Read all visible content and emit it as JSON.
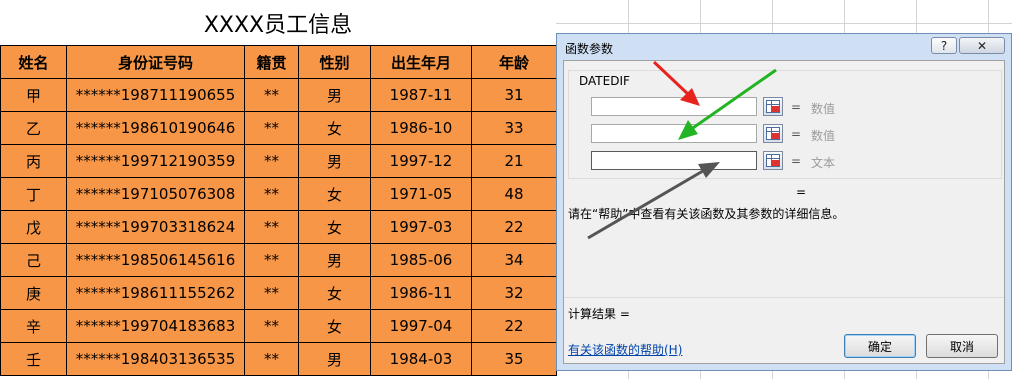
{
  "sheet": {
    "title": "XXXX员工信息",
    "headers": [
      "姓名",
      "身份证号码",
      "籍贯",
      "性别",
      "出生年月",
      "年龄"
    ],
    "rows": [
      [
        "甲",
        "******198711190655",
        "**",
        "男",
        "1987-11",
        "31"
      ],
      [
        "乙",
        "******198610190646",
        "**",
        "女",
        "1986-10",
        "33"
      ],
      [
        "丙",
        "******199712190359",
        "**",
        "男",
        "1997-12",
        "21"
      ],
      [
        "丁",
        "******197105076308",
        "**",
        "女",
        "1971-05",
        "48"
      ],
      [
        "戊",
        "******199703318624",
        "**",
        "女",
        "1997-03",
        "22"
      ],
      [
        "己",
        "******198506145616",
        "**",
        "男",
        "1985-06",
        "34"
      ],
      [
        "庚",
        "******198611155262",
        "**",
        "女",
        "1986-11",
        "32"
      ],
      [
        "辛",
        "******199704183683",
        "**",
        "女",
        "1997-04",
        "22"
      ],
      [
        "壬",
        "******198403136535",
        "**",
        "男",
        "1984-03",
        "35"
      ]
    ],
    "fill_color": "#f79646"
  },
  "dialog": {
    "title": "函数参数",
    "help_btn": "?",
    "close_btn": "✕",
    "function_name": "DATEDIF",
    "args": [
      {
        "value": "",
        "eq": "=",
        "result": "数值"
      },
      {
        "value": "",
        "eq": "=",
        "result": "数值"
      },
      {
        "value": "",
        "eq": "=",
        "result": "文本"
      }
    ],
    "result_eq": "=",
    "help_text": "请在“帮助”中查看有关该函数及其参数的详细信息。",
    "calc_result": "计算结果 =",
    "help_link": "有关该函数的帮助(H)",
    "ok": "确定",
    "cancel": "取消"
  },
  "annotations": {
    "arrow_colors": [
      "#e8231e",
      "#22b422",
      "#555555"
    ]
  }
}
